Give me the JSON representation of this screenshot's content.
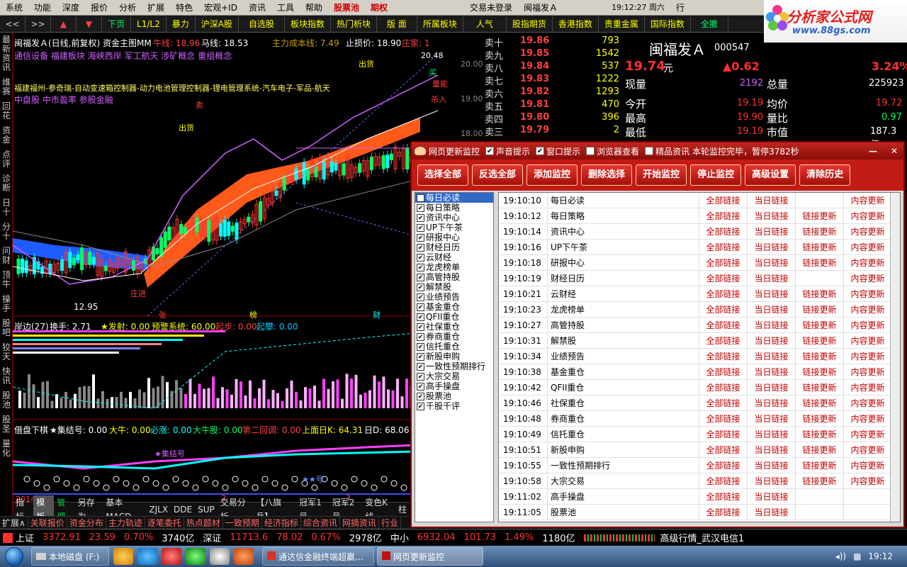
{
  "menu": [
    "系统",
    "功能",
    "深度",
    "报价",
    "分析",
    "扩展",
    "特色",
    "宏观+ID",
    "资讯",
    "工具",
    "帮助",
    "股票池",
    "期权"
  ],
  "menu_right": {
    "login": "交易未登录",
    "stock": "闽福发Ａ",
    "time": "19:12:27 周六",
    "btn": "行"
  },
  "logo": {
    "title": "分析家公式网",
    "url": "www.88gs.com"
  },
  "toolbar": {
    "arrows": [
      "<<",
      ">>",
      "▲",
      "▼"
    ],
    "items": [
      "下页",
      "L1/L2",
      "暴力",
      "沪深A股",
      "自选股",
      "板块指数",
      "热门析块",
      "版 面",
      "所属板块",
      "人气",
      "股指期货",
      "香港指数",
      "贵重金属",
      "国际指数",
      "全撤"
    ]
  },
  "sidebar": [
    "最新资讯",
    "维赛",
    "回花",
    "资金",
    "点评",
    "诊断",
    "日十",
    "分十",
    "问财",
    "顶牛",
    "操手",
    "股吧",
    "狡天",
    "快讯",
    "股池",
    "股圣",
    "量化"
  ],
  "chart": {
    "title": "闽福发Ａ(日线,前复权) 资金主图MM",
    "ma": [
      "牛线: 18.96",
      "马线: 18.53"
    ],
    "cost": "主力成本线: 7.49",
    "stop": "止损价: 18.90",
    "dealer": "庄家: 1",
    "concepts1": "通信设备 福建板块 海峡西岸 军工航天 涉矿概念 重组概念",
    "concepts2": "福建福州-参奇瑞-自动变速箱控制器-动力电池管理控制器-锂电管理系统-汽车电子-军品-航天",
    "concepts3": "中盘股 中市盈率 参股金融",
    "price_labels": [
      "20.00",
      "19.00",
      "18.00"
    ],
    "hi": "20.48",
    "low": "12.95",
    "marks": [
      "出货",
      "出货",
      "买",
      "卖",
      "量能",
      "杀入",
      "庄进",
      "张",
      "榜",
      "财"
    ],
    "ind1": {
      "a": "岸边(27)",
      "b": "换手: 2.71",
      "c": "★发射: 0.00",
      "d": "预警系统: 60.00",
      "e": "起步: 0.00",
      "f": "起攀: 0.00"
    },
    "ind2": {
      "a": "借盘下棋",
      "b": "★集结号: 0.00",
      "c": "大牛: 0.00",
      "d": "必涨: 0.00",
      "e": "大牛股: 0.00",
      "f": "第二回调: 0.00",
      "g": "上面日K: 64.31",
      "h": "日D: 68.06"
    },
    "ind2_labels": [
      "★集结号",
      "★★号"
    ],
    "xaxis": [
      "2014年",
      "2",
      "3"
    ],
    "colors": {
      "up": "#ff3030",
      "down": "#00ffff",
      "ma1": "#ffffff",
      "ribbon": "#ff5a1a",
      "blue": "#1e5cff"
    }
  },
  "bottom_tabs": [
    "指标",
    "模板",
    "管理",
    "另存为",
    "基本MACD",
    "ZJLX",
    "DDE",
    "SUP",
    "交易分析",
    "【八旗兵】",
    "冠军1号",
    "冠军2号",
    "变色K线",
    "柱"
  ],
  "sub_tabs": [
    "扩展∧",
    "关联报价",
    "资金分布",
    "主力轨迹",
    "逐笔委托",
    "热点题材",
    "一致预期",
    "经济指标",
    "综合资讯",
    "网摘资讯",
    "行业"
  ],
  "quote": {
    "name": "闽福发Ａ",
    "code": "000547",
    "price": "19.74",
    "price_unit": "元",
    "change": "▲0.62",
    "pct": "3.24%",
    "asks": [
      {
        "label": "卖十",
        "price": "19.86",
        "vol": "793"
      },
      {
        "label": "卖九",
        "price": "19.85",
        "vol": "1542"
      },
      {
        "label": "卖八",
        "price": "19.84",
        "vol": "537"
      },
      {
        "label": "卖七",
        "price": "19.83",
        "vol": "1222"
      },
      {
        "label": "卖六",
        "price": "19.82",
        "vol": "1293"
      },
      {
        "label": "卖五",
        "price": "19.81",
        "vol": "470"
      },
      {
        "label": "卖四",
        "price": "19.80",
        "vol": "396"
      },
      {
        "label": "卖三",
        "price": "19.79",
        "vol": "2"
      }
    ],
    "xianliang": {
      "label": "现量",
      "val": "2192"
    },
    "zongliang": {
      "label": "总量",
      "val": "225923"
    },
    "stats": [
      {
        "l": "今开",
        "v": "19.19",
        "l2": "均价",
        "v2": "19.72"
      },
      {
        "l": "最高",
        "v": "19.90",
        "l2": "量比",
        "v2": "0.97"
      },
      {
        "l": "最低",
        "v": "19.19",
        "l2": "市值",
        "v2": "187.3亿"
      }
    ]
  },
  "dialog": {
    "title": "网页更新监控",
    "checks": [
      {
        "label": "声音提示",
        "checked": "✔"
      },
      {
        "label": "窗口提示",
        "checked": "✔"
      },
      {
        "label": "浏览器查看",
        "checked": ""
      },
      {
        "label": "精品资讯",
        "checked": ""
      }
    ],
    "status": "本轮监控完毕，暂停3782秒",
    "buttons": [
      "选择全部",
      "反选全部",
      "添加监控",
      "删除选择",
      "开始监控",
      "停止监控",
      "高级设置",
      "清除历史"
    ],
    "list": [
      "每日必读",
      "每日策略",
      "资讯中心",
      "UP下午茶",
      "研报中心",
      "财经日历",
      "云财经",
      "龙虎榜单",
      "高管持股",
      "解禁股",
      "业绩预告",
      "基金重仓",
      "QFII重仓",
      "社保重仓",
      "券商重仓",
      "信托重仓",
      "新股申购",
      "一致性预期排行",
      "大宗交易",
      "高手操盘",
      "股票池",
      "千股千评"
    ],
    "rows": [
      {
        "time": "19:10:10",
        "name": "每日必读",
        "a": "全部链接",
        "b": "当日链接",
        "c": "",
        "d": "内容更新"
      },
      {
        "time": "19:10:12",
        "name": "每日策略",
        "a": "全部链接",
        "b": "当日链接",
        "c": "链接更新",
        "d": "内容更新"
      },
      {
        "time": "19:10:14",
        "name": "资讯中心",
        "a": "全部链接",
        "b": "当日链接",
        "c": "链接更新",
        "d": "内容更新"
      },
      {
        "time": "19:10:16",
        "name": "UP下午茶",
        "a": "全部链接",
        "b": "当日链接",
        "c": "链接更新",
        "d": "内容更新"
      },
      {
        "time": "19:10:18",
        "name": "研报中心",
        "a": "全部链接",
        "b": "当日链接",
        "c": "链接更新",
        "d": "内容更新"
      },
      {
        "time": "19:10:19",
        "name": "财经日历",
        "a": "全部链接",
        "b": "当日链接",
        "c": "",
        "d": "内容更新"
      },
      {
        "time": "19:10:21",
        "name": "云财经",
        "a": "全部链接",
        "b": "当日链接",
        "c": "链接更新",
        "d": "内容更新"
      },
      {
        "time": "19:10:23",
        "name": "龙虎榜单",
        "a": "全部链接",
        "b": "当日链接",
        "c": "链接更新",
        "d": "内容更新"
      },
      {
        "time": "19:10:27",
        "name": "高管持股",
        "a": "全部链接",
        "b": "当日链接",
        "c": "链接更新",
        "d": "内容更新"
      },
      {
        "time": "19:10:31",
        "name": "解禁股",
        "a": "全部链接",
        "b": "当日链接",
        "c": "链接更新",
        "d": "内容更新"
      },
      {
        "time": "19:10:34",
        "name": "业绩预告",
        "a": "全部链接",
        "b": "当日链接",
        "c": "链接更新",
        "d": "内容更新"
      },
      {
        "time": "19:10:38",
        "name": "基金重仓",
        "a": "全部链接",
        "b": "当日链接",
        "c": "链接更新",
        "d": "内容更新"
      },
      {
        "time": "19:10:42",
        "name": "QFII重仓",
        "a": "全部链接",
        "b": "当日链接",
        "c": "链接更新",
        "d": "内容更新"
      },
      {
        "time": "19:10:46",
        "name": "社保重仓",
        "a": "全部链接",
        "b": "当日链接",
        "c": "链接更新",
        "d": "内容更新"
      },
      {
        "time": "19:10:48",
        "name": "券商重仓",
        "a": "全部链接",
        "b": "当日链接",
        "c": "链接更新",
        "d": "内容更新"
      },
      {
        "time": "19:10:49",
        "name": "信托重仓",
        "a": "全部链接",
        "b": "当日链接",
        "c": "链接更新",
        "d": "内容更新"
      },
      {
        "time": "19:10:51",
        "name": "新股申购",
        "a": "全部链接",
        "b": "当日链接",
        "c": "链接更新",
        "d": "内容更新"
      },
      {
        "time": "19:10:55",
        "name": "一致性预期排行",
        "a": "全部链接",
        "b": "当日链接",
        "c": "链接更新",
        "d": "内容更新"
      },
      {
        "time": "19:10:58",
        "name": "大宗交易",
        "a": "全部链接",
        "b": "当日链接",
        "c": "链接更新",
        "d": "内容更新"
      },
      {
        "time": "19:11:02",
        "name": "高手操盘",
        "a": "全部链接",
        "b": "当日链接",
        "c": "",
        "d": ""
      },
      {
        "time": "19:11:05",
        "name": "股票池",
        "a": "全部链接",
        "b": "当日链接",
        "c": "",
        "d": ""
      }
    ]
  },
  "statusbar": [
    {
      "name": "上证",
      "price": "3372.91",
      "chg": "23.59",
      "pct": "0.70%",
      "amt": "3740亿"
    },
    {
      "name": "深证",
      "price": "11713.6",
      "chg": "78.02",
      "pct": "0.67%",
      "amt": "2978亿"
    },
    {
      "name": "中小",
      "price": "6932.04",
      "chg": "101.73",
      "pct": "1.49%",
      "amt": "1180亿"
    }
  ],
  "status_right": "高级行情_武汉电信1",
  "taskbar": {
    "tasks": [
      "本地磁盘 (F:)",
      "通达信金融终端超赢...",
      "网页更新监控"
    ],
    "clock": "19:12"
  }
}
